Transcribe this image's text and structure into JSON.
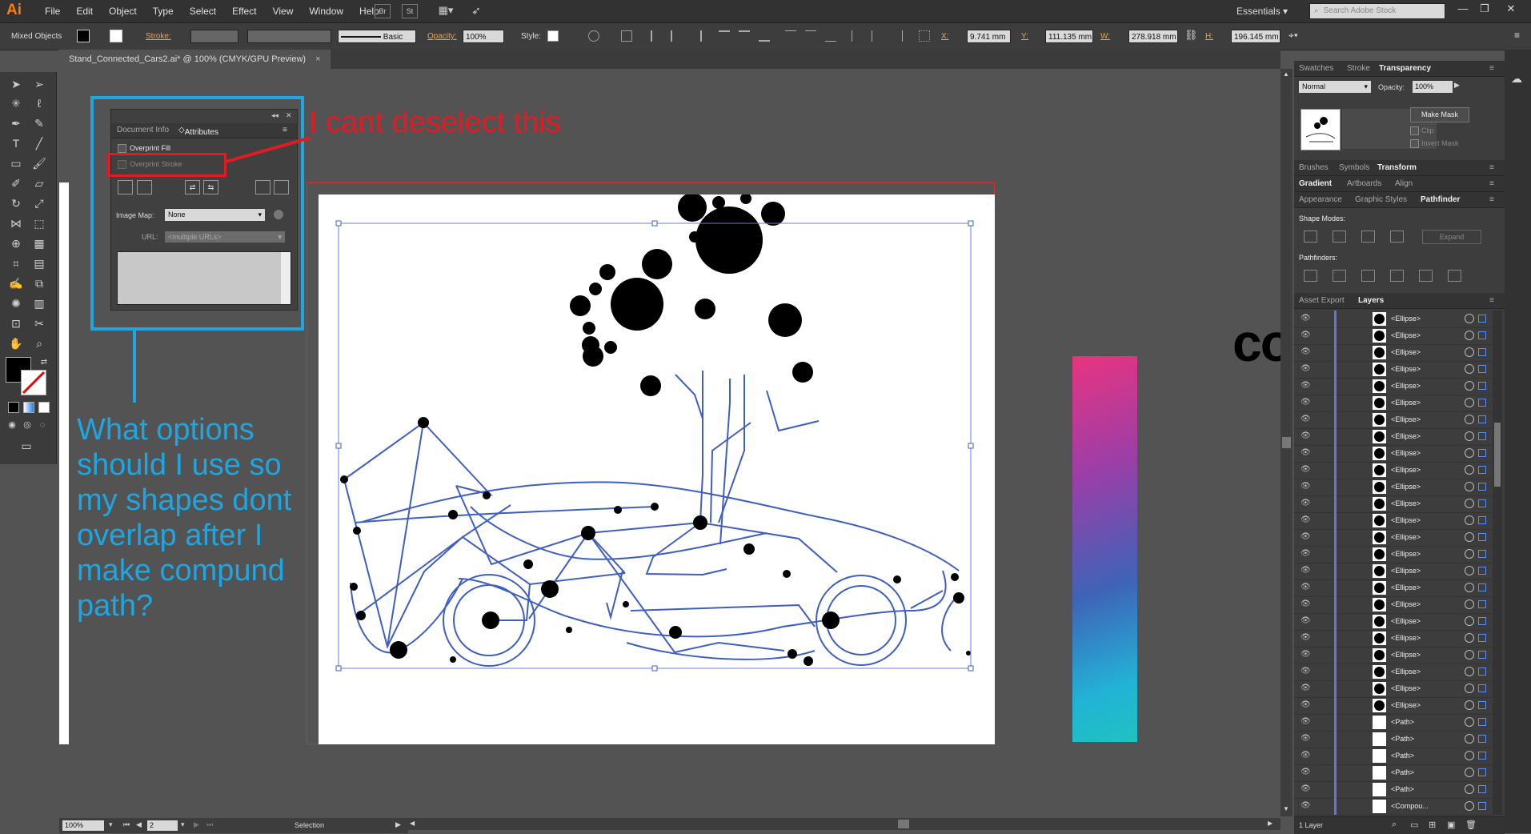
{
  "app": {
    "logo": "Ai",
    "menus": [
      "File",
      "Edit",
      "Object",
      "Type",
      "Select",
      "Effect",
      "View",
      "Window",
      "Help"
    ],
    "menubar_icons": [
      "Br",
      "St"
    ],
    "workspace": "Essentials",
    "stock_search_placeholder": "Search Adobe Stock"
  },
  "control_bar": {
    "selection_type": "Mixed Objects",
    "stroke_label": "Stroke:",
    "brush": "Basic",
    "opacity_label": "Opacity:",
    "opacity_value": "100%",
    "style_label": "Style:",
    "x_label": "X:",
    "x_value": "9.741 mm",
    "y_label": "Y:",
    "y_value": "111.135 mm",
    "w_label": "W:",
    "w_value": "278.918 mm",
    "h_label": "H:",
    "h_value": "196.145 mm"
  },
  "document": {
    "tab_title": "Stand_Connected_Cars2.ai* @ 100% (CMYK/GPU Preview)",
    "tab_close": "×"
  },
  "attributes_panel": {
    "tab_document_info": "Document Info",
    "tab_attributes": "Attributes",
    "overprint_fill": "Overprint Fill",
    "overprint_stroke": "Overprint Stroke",
    "image_map_label": "Image Map:",
    "image_map_value": "None",
    "url_label": "URL:",
    "url_value": "<multiple URLs>"
  },
  "annotations": {
    "red_text": "I cant deselect this",
    "blue_text": "What options should I use so my shapes dont overlap after I make compund path?"
  },
  "canvas_text": "co",
  "status_bar": {
    "zoom": "100%",
    "artboard": "2",
    "tool": "Selection"
  },
  "transparency_panel": {
    "tabs": [
      "Swatches",
      "Stroke",
      "Transparency"
    ],
    "blend_mode": "Normal",
    "opacity_label": "Opacity:",
    "opacity_value": "100%",
    "make_mask": "Make Mask",
    "clip": "Clip",
    "invert_mask": "Invert Mask"
  },
  "panel_groups": {
    "row1": [
      "Brushes",
      "Symbols",
      "Transform"
    ],
    "row2": [
      "Gradient",
      "Artboards",
      "Align"
    ],
    "row3": [
      "Appearance",
      "Graphic Styles",
      "Pathfinder"
    ]
  },
  "pathfinder": {
    "shape_modes": "Shape Modes:",
    "expand": "Expand",
    "pathfinders": "Pathfinders:"
  },
  "layers_panel": {
    "tabs": [
      "Asset Export",
      "Layers"
    ],
    "footer": "1 Layer",
    "items": [
      {
        "name": "<Ellipse>",
        "thumb": "ellipse"
      },
      {
        "name": "<Ellipse>",
        "thumb": "ellipse"
      },
      {
        "name": "<Ellipse>",
        "thumb": "ellipse"
      },
      {
        "name": "<Ellipse>",
        "thumb": "ellipse"
      },
      {
        "name": "<Ellipse>",
        "thumb": "ellipse"
      },
      {
        "name": "<Ellipse>",
        "thumb": "ellipse"
      },
      {
        "name": "<Ellipse>",
        "thumb": "ellipse"
      },
      {
        "name": "<Ellipse>",
        "thumb": "ellipse"
      },
      {
        "name": "<Ellipse>",
        "thumb": "ellipse"
      },
      {
        "name": "<Ellipse>",
        "thumb": "ellipse"
      },
      {
        "name": "<Ellipse>",
        "thumb": "ellipse"
      },
      {
        "name": "<Ellipse>",
        "thumb": "ellipse"
      },
      {
        "name": "<Ellipse>",
        "thumb": "ellipse"
      },
      {
        "name": "<Ellipse>",
        "thumb": "ellipse"
      },
      {
        "name": "<Ellipse>",
        "thumb": "ellipse"
      },
      {
        "name": "<Ellipse>",
        "thumb": "ellipse"
      },
      {
        "name": "<Ellipse>",
        "thumb": "ellipse"
      },
      {
        "name": "<Ellipse>",
        "thumb": "ellipse"
      },
      {
        "name": "<Ellipse>",
        "thumb": "ellipse"
      },
      {
        "name": "<Ellipse>",
        "thumb": "ellipse"
      },
      {
        "name": "<Ellipse>",
        "thumb": "ellipse"
      },
      {
        "name": "<Ellipse>",
        "thumb": "ellipse"
      },
      {
        "name": "<Ellipse>",
        "thumb": "ellipse"
      },
      {
        "name": "<Ellipse>",
        "thumb": "ellipse"
      },
      {
        "name": "<Path>",
        "thumb": "path"
      },
      {
        "name": "<Path>",
        "thumb": "path"
      },
      {
        "name": "<Path>",
        "thumb": "path"
      },
      {
        "name": "<Path>",
        "thumb": "path"
      },
      {
        "name": "<Path>",
        "thumb": "path"
      },
      {
        "name": "<Compou...",
        "thumb": "path"
      }
    ]
  },
  "colors": {
    "accent_orange": "#ff7c00",
    "annotation_red": "#e21b23",
    "annotation_blue": "#1fa5e0",
    "path_blue": "#3f5fbf"
  }
}
